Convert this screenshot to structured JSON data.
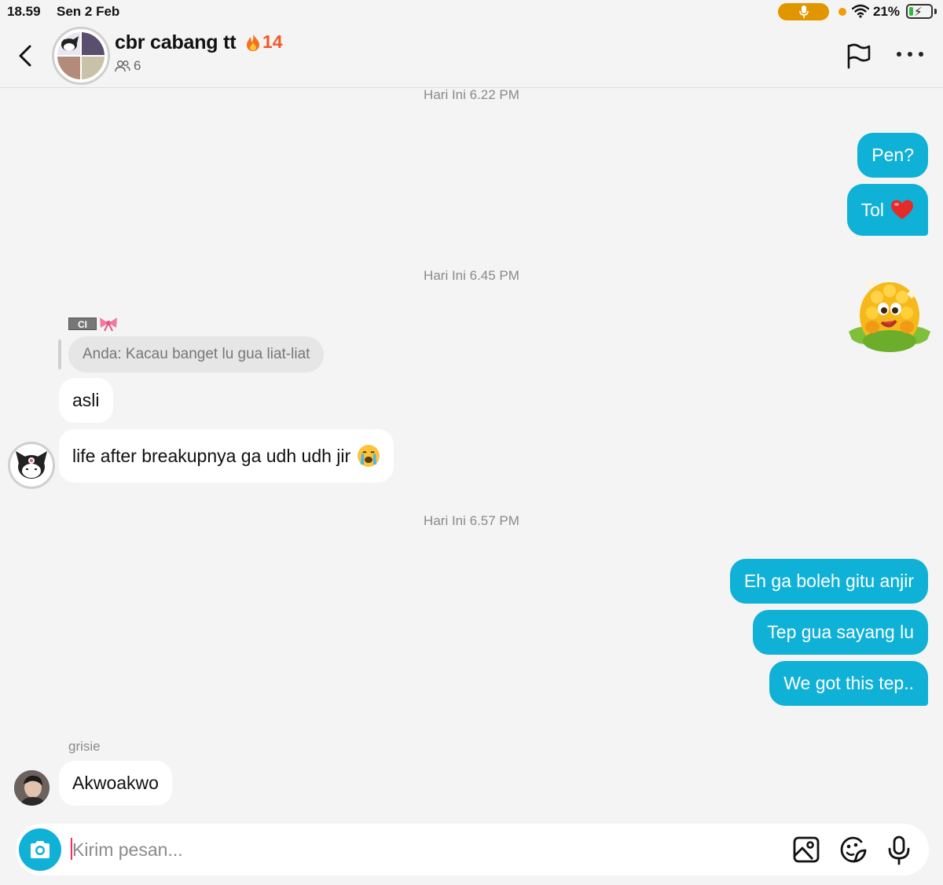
{
  "status_bar": {
    "time": "18.59",
    "date": "Sen 2 Feb",
    "battery_percent": "21%",
    "battery_level": 0.21
  },
  "header": {
    "title": "cbr cabang tt",
    "streak": "14",
    "member_count": "6"
  },
  "messages": {
    "ts1": "Hari Ini 6.22 PM",
    "out1": "Pen?",
    "out2": "Tol",
    "ts2": "Hari Ini 6.45 PM",
    "sender_tag": "CI",
    "reply_quote": "Anda: Kacau banget lu gua liat-liat",
    "in1": "asli",
    "in2": "life after breakupnya ga udh udh jir",
    "ts3": "Hari Ini 6.57 PM",
    "out3": "Eh ga boleh gitu anjir",
    "out4": "Tep gua sayang lu",
    "out5": "We got this tep..",
    "sender2": "grisie",
    "in3": "Akwoakwo"
  },
  "composer": {
    "placeholder": "Kirim pesan..."
  },
  "colors": {
    "accent": "#0fb1d6",
    "streak": "#f05a28",
    "background": "#f4f4f4"
  }
}
